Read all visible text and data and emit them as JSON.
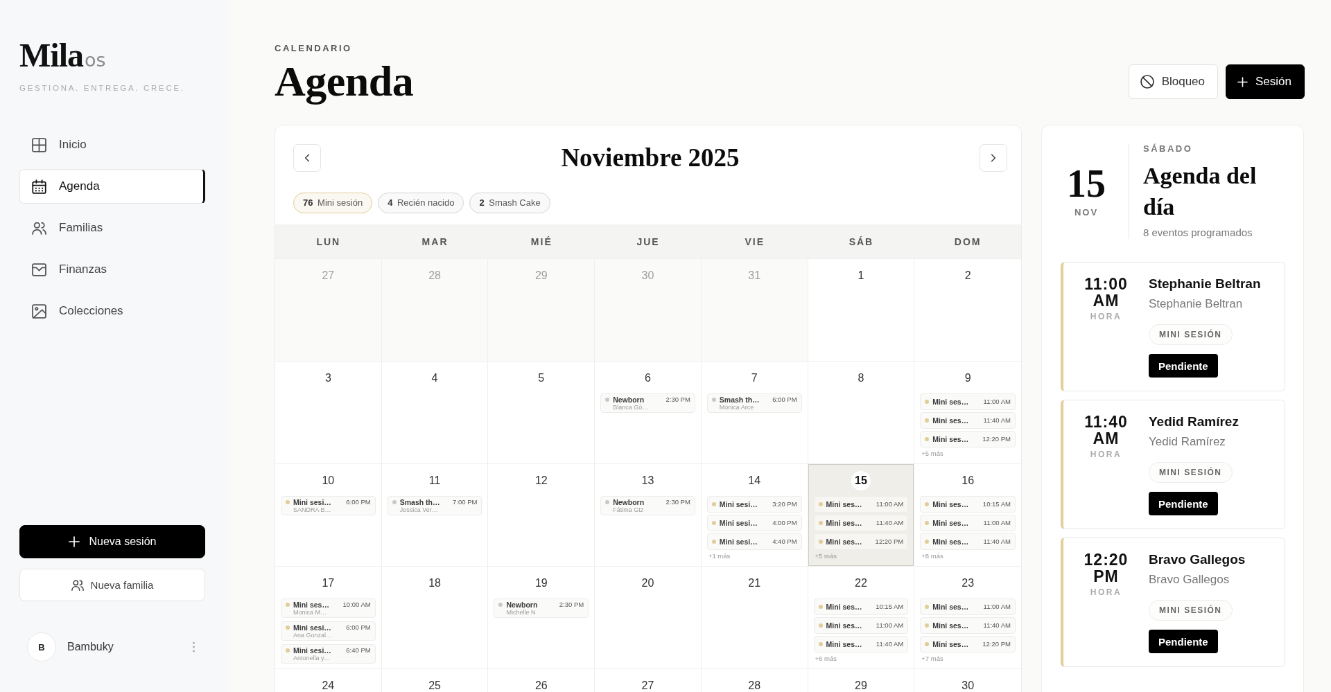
{
  "sidebar": {
    "logo": {
      "name": "Mila",
      "suffix": "os"
    },
    "tagline": "GESTIONA. ENTREGA. CRECE.",
    "nav": [
      {
        "label": "Inicio",
        "selected": false
      },
      {
        "label": "Agenda",
        "selected": true
      },
      {
        "label": "Familias",
        "selected": false
      },
      {
        "label": "Finanzas",
        "selected": false
      },
      {
        "label": "Colecciones",
        "selected": false
      }
    ],
    "actions": [
      {
        "label": "Nueva sesión",
        "kind": "primary"
      },
      {
        "label": "Nueva familia",
        "kind": "secondary"
      }
    ],
    "user": {
      "initial": "B",
      "name": "Bambuky"
    }
  },
  "header": {
    "eyebrow": "CALENDARIO",
    "title": "Agenda",
    "buttons": [
      {
        "label": "Bloqueo",
        "kind": "secondary"
      },
      {
        "label": "Sesión",
        "kind": "primary"
      }
    ]
  },
  "calendar": {
    "month": "Noviembre 2025",
    "filters": [
      {
        "count": "76",
        "label": "Mini sesión",
        "color": "#e2cc98"
      },
      {
        "count": "4",
        "label": "Recién nacido",
        "color": "#d4d4d4"
      },
      {
        "count": "2",
        "label": "Smash Cake",
        "color": "#d4d4d4"
      }
    ],
    "weekdays": [
      "LUN",
      "MAR",
      "MIÉ",
      "JUE",
      "VIE",
      "SÁB",
      "DOM"
    ],
    "weeks": [
      {
        "days": [
          {
            "day": "27",
            "other_month": true,
            "selected": false
          },
          {
            "day": "28",
            "other_month": true,
            "selected": false
          },
          {
            "day": "29",
            "other_month": true,
            "selected": false
          },
          {
            "day": "30",
            "other_month": true,
            "selected": false
          },
          {
            "day": "31",
            "other_month": true,
            "selected": false
          },
          {
            "day": "1",
            "other_month": false,
            "selected": false
          },
          {
            "day": "2",
            "other_month": false,
            "selected": false
          }
        ]
      },
      {
        "days": [
          {
            "day": "3",
            "other_month": false,
            "selected": false
          },
          {
            "day": "4",
            "other_month": false,
            "selected": false
          },
          {
            "day": "5",
            "other_month": false,
            "selected": false
          },
          {
            "day": "6",
            "other_month": false,
            "selected": false,
            "events": [
              {
                "title": "Newborn",
                "time": "2:30 PM",
                "client": "Blanca Gó…",
                "color": "#c9c9c9"
              }
            ]
          },
          {
            "day": "7",
            "other_month": false,
            "selected": false,
            "events": [
              {
                "title": "Smash th…",
                "time": "6:00 PM",
                "client": "Mónica Arce",
                "color": "#c9c9c9"
              }
            ]
          },
          {
            "day": "8",
            "other_month": false,
            "selected": false
          },
          {
            "day": "9",
            "other_month": false,
            "selected": false,
            "events": [
              {
                "title": "Mini ses…",
                "time": "11:00 AM",
                "color": "#e2cc98"
              },
              {
                "title": "Mini ses…",
                "time": "11:40 AM",
                "color": "#e2cc98"
              },
              {
                "title": "Mini ses…",
                "time": "12:20 PM",
                "color": "#e2cc98"
              }
            ],
            "more": "+5 más"
          }
        ]
      },
      {
        "days": [
          {
            "day": "10",
            "other_month": false,
            "selected": false,
            "events": [
              {
                "title": "Mini sesi…",
                "time": "6:00 PM",
                "client": "SANDRA B…",
                "color": "#e2cc98"
              }
            ]
          },
          {
            "day": "11",
            "other_month": false,
            "selected": false,
            "events": [
              {
                "title": "Smash th…",
                "time": "7:00 PM",
                "client": "Jessica Ver…",
                "color": "#c9c9c9"
              }
            ]
          },
          {
            "day": "12",
            "other_month": false,
            "selected": false
          },
          {
            "day": "13",
            "other_month": false,
            "selected": false,
            "events": [
              {
                "title": "Newborn",
                "time": "2:30 PM",
                "client": "Fátima Gtz",
                "color": "#c9c9c9"
              }
            ]
          },
          {
            "day": "14",
            "other_month": false,
            "selected": false,
            "events": [
              {
                "title": "Mini sesi…",
                "time": "3:20 PM",
                "color": "#e2cc98"
              },
              {
                "title": "Mini sesi…",
                "time": "4:00 PM",
                "color": "#e2cc98"
              },
              {
                "title": "Mini sesi…",
                "time": "4:40 PM",
                "color": "#e2cc98"
              }
            ],
            "more": "+1 más"
          },
          {
            "day": "15",
            "other_month": false,
            "selected": true,
            "events": [
              {
                "title": "Mini ses…",
                "time": "11:00 AM",
                "color": "#e2cc98"
              },
              {
                "title": "Mini ses…",
                "time": "11:40 AM",
                "color": "#e2cc98"
              },
              {
                "title": "Mini ses…",
                "time": "12:20 PM",
                "color": "#e2cc98"
              }
            ],
            "more": "+5 más"
          },
          {
            "day": "16",
            "other_month": false,
            "selected": false,
            "events": [
              {
                "title": "Mini ses…",
                "time": "10:15 AM",
                "color": "#e2cc98"
              },
              {
                "title": "Mini ses…",
                "time": "11:00 AM",
                "color": "#e2cc98"
              },
              {
                "title": "Mini ses…",
                "time": "11:40 AM",
                "color": "#e2cc98"
              }
            ],
            "more": "+8 más"
          }
        ]
      },
      {
        "days": [
          {
            "day": "17",
            "other_month": false,
            "selected": false,
            "events": [
              {
                "title": "Mini ses…",
                "time": "10:00 AM",
                "client": "Monica M…",
                "color": "#e2cc98"
              },
              {
                "title": "Mini sesi…",
                "time": "6:00 PM",
                "client": "Ana Gonzal…",
                "color": "#e2cc98"
              },
              {
                "title": "Mini sesi…",
                "time": "6:40 PM",
                "client": "Antonella y…",
                "color": "#e2cc98"
              }
            ]
          },
          {
            "day": "18",
            "other_month": false,
            "selected": false
          },
          {
            "day": "19",
            "other_month": false,
            "selected": false,
            "events": [
              {
                "title": "Newborn",
                "time": "2:30 PM",
                "client": "Michelle N",
                "color": "#c9c9c9"
              }
            ]
          },
          {
            "day": "20",
            "other_month": false,
            "selected": false
          },
          {
            "day": "21",
            "other_month": false,
            "selected": false
          },
          {
            "day": "22",
            "other_month": false,
            "selected": false,
            "events": [
              {
                "title": "Mini ses…",
                "time": "10:15 AM",
                "color": "#e2cc98"
              },
              {
                "title": "Mini ses…",
                "time": "11:00 AM",
                "color": "#e2cc98"
              },
              {
                "title": "Mini ses…",
                "time": "11:40 AM",
                "color": "#e2cc98"
              }
            ],
            "more": "+6 más"
          },
          {
            "day": "23",
            "other_month": false,
            "selected": false,
            "events": [
              {
                "title": "Mini ses…",
                "time": "11:00 AM",
                "color": "#e2cc98"
              },
              {
                "title": "Mini ses…",
                "time": "11:40 AM",
                "color": "#e2cc98"
              },
              {
                "title": "Mini ses…",
                "time": "12:20 PM",
                "color": "#e2cc98"
              }
            ],
            "more": "+7 más"
          }
        ]
      },
      {
        "days": [
          {
            "day": "24",
            "other_month": false,
            "selected": false
          },
          {
            "day": "25",
            "other_month": false,
            "selected": false
          },
          {
            "day": "26",
            "other_month": false,
            "selected": false
          },
          {
            "day": "27",
            "other_month": false,
            "selected": false
          },
          {
            "day": "28",
            "other_month": false,
            "selected": false
          },
          {
            "day": "29",
            "other_month": false,
            "selected": false
          },
          {
            "day": "30",
            "other_month": false,
            "selected": false
          }
        ]
      }
    ]
  },
  "day_panel": {
    "day": "15",
    "month": "NOV",
    "weekday": "SÁBADO",
    "title": "Agenda del día",
    "count": "8 eventos programados",
    "appointments": [
      {
        "time": "11:00",
        "period": "AM",
        "caption": "HORA",
        "client": "Stephanie Beltran",
        "family": "Stephanie Beltran",
        "tag": "MINI SESIÓN",
        "status": "Pendiente"
      },
      {
        "time": "11:40",
        "period": "AM",
        "caption": "HORA",
        "client": "Yedid Ramírez",
        "family": "Yedid Ramírez",
        "tag": "MINI SESIÓN",
        "status": "Pendiente"
      },
      {
        "time": "12:20",
        "period": "PM",
        "caption": "HORA",
        "client": "Bravo Gallegos",
        "family": "Bravo Gallegos",
        "tag": "MINI SESIÓN",
        "status": "Pendiente"
      }
    ]
  }
}
